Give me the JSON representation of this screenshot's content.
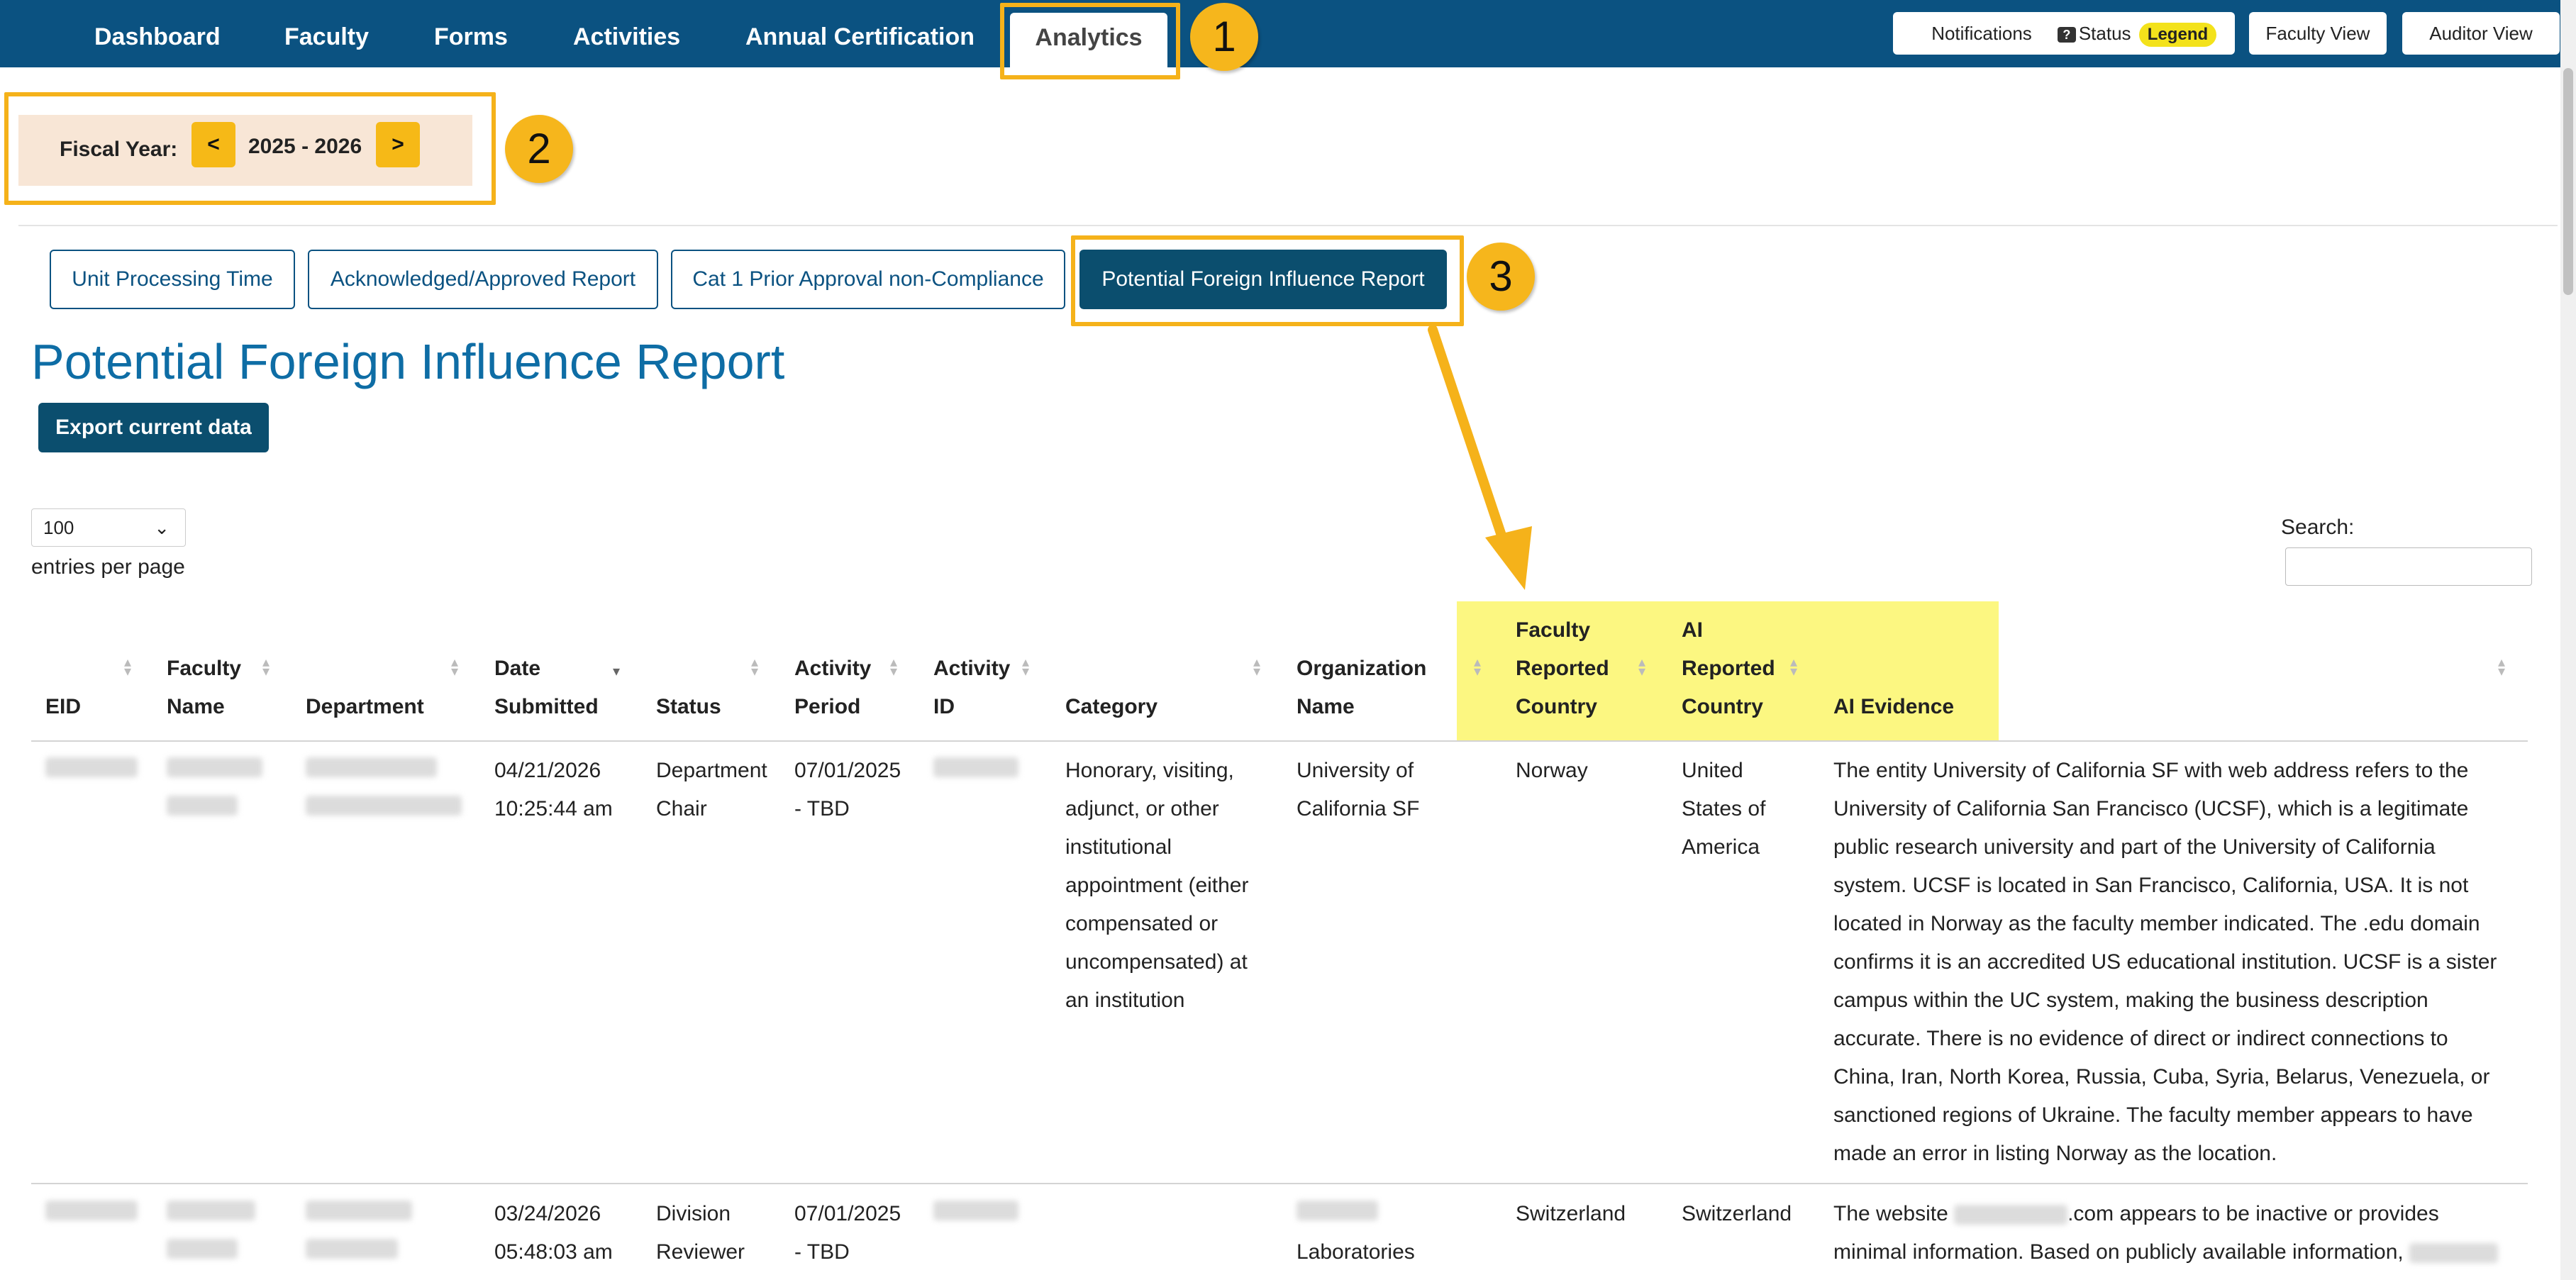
{
  "nav": {
    "items": [
      "Dashboard",
      "Faculty",
      "Forms",
      "Activities",
      "Annual Certification"
    ],
    "active": "Analytics",
    "right_buttons": {
      "notifications": "Notifications",
      "status": "Status",
      "legend": "Legend",
      "faculty_view": "Faculty View",
      "auditor_view": "Auditor View"
    }
  },
  "callouts": [
    "1",
    "2",
    "3"
  ],
  "fiscal_year": {
    "label": "Fiscal Year:",
    "prev": "<",
    "value": "2025 - 2026",
    "next": ">"
  },
  "report_tabs": [
    "Unit Processing Time",
    "Acknowledged/Approved Report",
    "Cat 1 Prior Approval non-Compliance",
    "Potential Foreign Influence Report"
  ],
  "active_tab_index": 3,
  "page_title": "Potential Foreign Influence Report",
  "export_label": "Export current data",
  "entries": {
    "value": "100",
    "label": "entries per page"
  },
  "search": {
    "label": "Search:",
    "value": ""
  },
  "table": {
    "headers": {
      "eid": "EID",
      "faculty_name": [
        "Faculty",
        "Name"
      ],
      "department": "Department",
      "date_submitted": [
        "Date",
        "Submitted"
      ],
      "status": "Status",
      "activity_period": [
        "Activity",
        "Period"
      ],
      "activity_id": [
        "Activity",
        "ID"
      ],
      "category": "Category",
      "organization_name": [
        "Organization",
        "Name"
      ],
      "faculty_reported_country": [
        "Faculty",
        "Reported",
        "Country"
      ],
      "ai_reported_country": [
        "AI",
        "Reported",
        "Country"
      ],
      "ai_evidence": "AI Evidence"
    },
    "rows": [
      {
        "date_submitted": [
          "04/21/2026",
          "10:25:44 am"
        ],
        "status": [
          "Department",
          "Chair"
        ],
        "activity_period": [
          "07/01/2025",
          "- TBD"
        ],
        "category": [
          "Honorary, visiting,",
          "adjunct, or other",
          "institutional",
          "appointment (either",
          "compensated or",
          "uncompensated) at",
          "an institution"
        ],
        "organization": [
          "University of",
          "California SF"
        ],
        "faculty_country": "Norway",
        "ai_country": [
          "United",
          "States of",
          "America"
        ],
        "ai_evidence": [
          "The entity University of California SF with web address refers to the",
          "University of California San Francisco (UCSF), which is a legitimate",
          "public research university and part of the University of California",
          "system. UCSF is located in San Francisco, California, USA. It is not",
          "located in Norway as the faculty member indicated. The .edu domain",
          "confirms it is an accredited US educational institution. UCSF is a sister",
          "campus within the UC system, making the business description",
          "accurate. There is no evidence of direct or indirect connections to",
          "China, Iran, North Korea, Russia, Cuba, Syria, Belarus, Venezuela, or",
          "sanctioned regions of Ukraine. The faculty member appears to have",
          "made an error in listing Norway as the location."
        ]
      },
      {
        "date_submitted": [
          "03/24/2026",
          "05:48:03 am"
        ],
        "status": [
          "Division",
          "Reviewer"
        ],
        "activity_period": [
          "07/01/2025",
          "- TBD"
        ],
        "organization_line2": "Laboratories",
        "faculty_country": "Switzerland",
        "ai_country": "Switzerland",
        "ai_evidence_parts": [
          "The website",
          ".com appears to be inactive or provides"
        ],
        "ai_evidence_line2": "minimal information. Based on publicly available information,"
      }
    ]
  }
}
